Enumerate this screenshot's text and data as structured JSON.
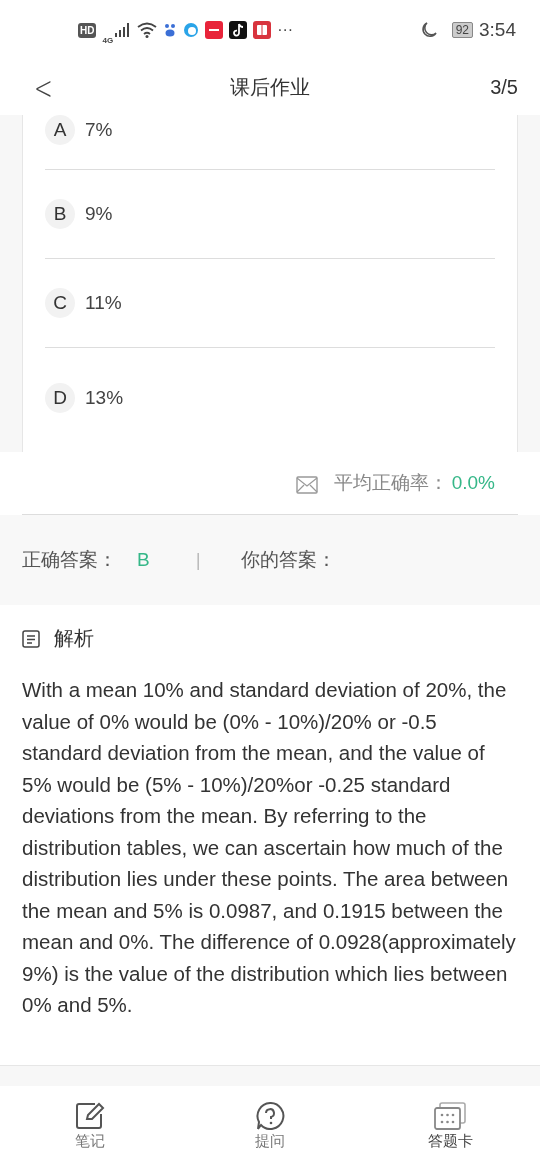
{
  "status_bar": {
    "hd": "HD",
    "network": "4G",
    "more": "···",
    "battery": "92",
    "time": "3:54"
  },
  "header": {
    "back": "<",
    "title": "课后作业",
    "progress": "3/5"
  },
  "options": [
    {
      "letter": "A",
      "text": "7%"
    },
    {
      "letter": "B",
      "text": "9%"
    },
    {
      "letter": "C",
      "text": "11%"
    },
    {
      "letter": "D",
      "text": "13%"
    }
  ],
  "accuracy": {
    "label": "平均正确率：",
    "value": "0.0%"
  },
  "answers": {
    "correct_label": "正确答案：",
    "correct_value": "B",
    "separator": "|",
    "yours_label": "你的答案："
  },
  "analysis": {
    "title": "解析",
    "text": "With a mean 10% and standard deviation of 20%, the value of 0% would be (0% - 10%)/20% or -0.5 standard deviation from the mean, and the value of 5% would be (5% - 10%)/20%or -0.25 standard deviations from the mean. By referring to the distribution tables, we can ascertain how much of the distribution lies under these points. The area between the mean and 5% is 0.0987, and 0.1915 between the mean and 0%. The difference of 0.0928(approximately 9%) is the value of the distribution which lies between 0% and 5%."
  },
  "bottom_nav": [
    {
      "kind": "note",
      "label": "笔记"
    },
    {
      "kind": "ask",
      "label": "提问"
    },
    {
      "kind": "card",
      "label": "答题卡"
    }
  ]
}
